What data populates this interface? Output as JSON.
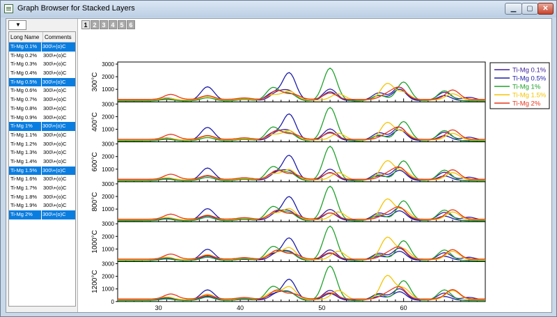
{
  "window": {
    "title": "Graph Browser for Stacked Layers"
  },
  "list": {
    "headers": {
      "long_name": "Long Name",
      "comments": "Comments"
    },
    "rows": [
      {
        "name": "Ti-Mg 0.1%",
        "comment": "300\\+(o)C",
        "selected": true
      },
      {
        "name": "Ti-Mg 0.2%",
        "comment": "300\\+(o)C",
        "selected": false
      },
      {
        "name": "Ti-Mg 0.3%",
        "comment": "300\\+(o)C",
        "selected": false
      },
      {
        "name": "Ti-Mg 0.4%",
        "comment": "300\\+(o)C",
        "selected": false
      },
      {
        "name": "Ti-Mg 0.5%",
        "comment": "300\\+(o)C",
        "selected": true
      },
      {
        "name": "Ti-Mg 0.6%",
        "comment": "300\\+(o)C",
        "selected": false
      },
      {
        "name": "Ti-Mg 0.7%",
        "comment": "300\\+(o)C",
        "selected": false
      },
      {
        "name": "Ti-Mg 0.8%",
        "comment": "300\\+(o)C",
        "selected": false
      },
      {
        "name": "Ti-Mg 0.9%",
        "comment": "300\\+(o)C",
        "selected": false
      },
      {
        "name": "Ti-Mg 1%",
        "comment": "300\\+(o)C",
        "selected": true
      },
      {
        "name": "Ti-Mg 1.1%",
        "comment": "300\\+(o)C",
        "selected": false
      },
      {
        "name": "Ti-Mg 1.2%",
        "comment": "300\\+(o)C",
        "selected": false
      },
      {
        "name": "Ti-Mg 1.3%",
        "comment": "300\\+(o)C",
        "selected": false
      },
      {
        "name": "Ti-Mg 1.4%",
        "comment": "300\\+(o)C",
        "selected": false
      },
      {
        "name": "Ti-Mg 1.5%",
        "comment": "300\\+(o)C",
        "selected": true
      },
      {
        "name": "Ti-Mg 1.6%",
        "comment": "300\\+(o)C",
        "selected": false
      },
      {
        "name": "Ti-Mg 1.7%",
        "comment": "300\\+(o)C",
        "selected": false
      },
      {
        "name": "Ti-Mg 1.8%",
        "comment": "300\\+(o)C",
        "selected": false
      },
      {
        "name": "Ti-Mg 1.9%",
        "comment": "300\\+(o)C",
        "selected": false
      },
      {
        "name": "Ti-Mg 2%",
        "comment": "300\\+(o)C",
        "selected": true
      }
    ]
  },
  "layer_tabs": [
    "1",
    "2",
    "3",
    "4",
    "5",
    "6"
  ],
  "active_layer": "1",
  "chart_data": {
    "type": "line",
    "x_range": [
      25,
      70
    ],
    "x_ticks": [
      "30",
      "40",
      "50",
      "60"
    ],
    "y_ticks": [
      "0",
      "1000",
      "2000",
      "3000"
    ],
    "panel_ylim": [
      0,
      3000
    ],
    "panels": [
      "300°C",
      "400°C",
      "600°C",
      "800°C",
      "1000°C",
      "1200°C"
    ],
    "legend": [
      "Ti-Mg 0.1%",
      "Ti-Mg 0.5%",
      "Ti-Mg 1%",
      "Ti-Mg 1.5%",
      "Ti-Mg 2%"
    ],
    "colors": [
      "#3c1f9b",
      "#1c1ca8",
      "#1ea12a",
      "#f5c400",
      "#e8361c"
    ],
    "series": [
      {
        "name": "Ti-Mg 0.1%",
        "baseline": 120,
        "peaks": [
          [
            31,
            200
          ],
          [
            36,
            350
          ],
          [
            40.5,
            150
          ],
          [
            44.5,
            600
          ],
          [
            46,
            700
          ],
          [
            51,
            900
          ],
          [
            57,
            600
          ],
          [
            59.5,
            1050
          ],
          [
            65,
            650
          ],
          [
            68,
            250
          ]
        ]
      },
      {
        "name": "Ti-Mg 0.5%",
        "baseline": 100,
        "peaks": [
          [
            31,
            150
          ],
          [
            36,
            1100
          ],
          [
            40.5,
            100
          ],
          [
            44,
            600
          ],
          [
            46,
            2200
          ],
          [
            51,
            700
          ],
          [
            57,
            400
          ],
          [
            59.5,
            900
          ],
          [
            65,
            400
          ]
        ]
      },
      {
        "name": "Ti-Mg 1%",
        "baseline": 80,
        "peaks": [
          [
            31,
            120
          ],
          [
            36,
            250
          ],
          [
            40.5,
            120
          ],
          [
            44,
            1050
          ],
          [
            46,
            600
          ],
          [
            51,
            2600
          ],
          [
            57,
            450
          ],
          [
            60,
            1500
          ],
          [
            65,
            800
          ]
        ]
      },
      {
        "name": "Ti-Mg 1.5%",
        "baseline": 150,
        "peaks": [
          [
            31,
            150
          ],
          [
            36,
            300
          ],
          [
            40.5,
            100
          ],
          [
            44,
            400
          ],
          [
            46,
            700
          ],
          [
            52,
            500
          ],
          [
            58,
            1300
          ],
          [
            60,
            600
          ],
          [
            66,
            500
          ]
        ]
      },
      {
        "name": "Ti-Mg 2%",
        "baseline": 200,
        "peaks": [
          [
            31.5,
            400
          ],
          [
            36,
            300
          ],
          [
            40.5,
            120
          ],
          [
            44.5,
            700
          ],
          [
            46.5,
            400
          ],
          [
            51,
            500
          ],
          [
            58,
            400
          ],
          [
            59.5,
            900
          ],
          [
            66,
            750
          ]
        ]
      }
    ],
    "panel_scale": [
      [
        1,
        1,
        1,
        1,
        1
      ],
      [
        1,
        0.95,
        1.02,
        1.05,
        1
      ],
      [
        0.98,
        0.9,
        1.05,
        1.15,
        1
      ],
      [
        0.95,
        0.85,
        1.05,
        1.25,
        1
      ],
      [
        0.9,
        0.8,
        1.05,
        1.35,
        1
      ],
      [
        0.85,
        0.75,
        1.05,
        1.45,
        1
      ]
    ]
  }
}
